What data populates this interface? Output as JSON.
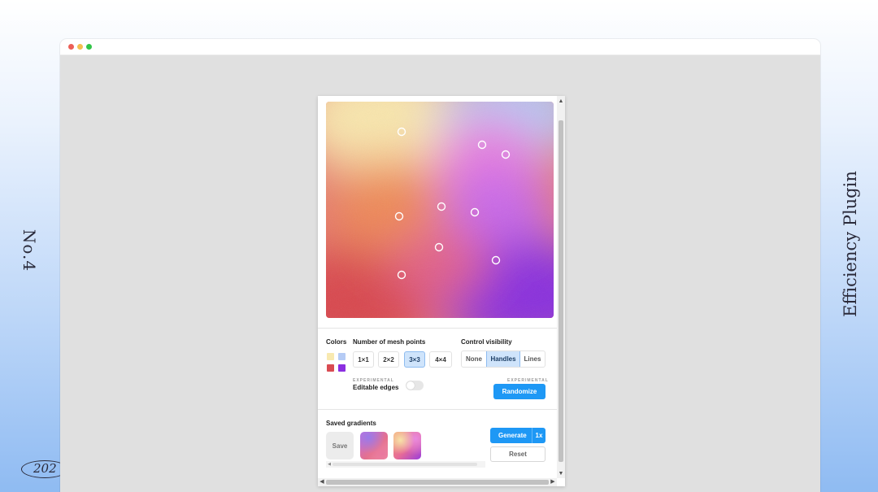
{
  "decor": {
    "left_text": "No.4",
    "right_text": "Efficiency Plugin",
    "year_text": "202"
  },
  "canvas": {
    "colors": [
      "#f8e9b0",
      "#b5cbf5",
      "#d94b52",
      "#8b2fe0"
    ]
  },
  "controls": {
    "colors_label": "Colors",
    "swatches": [
      "#f8e9b0",
      "#b5cbf5",
      "#d94b52",
      "#8b2fe0"
    ],
    "mesh_label": "Number of mesh points",
    "mesh_options": [
      "1×1",
      "2×2",
      "3×3",
      "4×4"
    ],
    "mesh_selected": "3×3",
    "visibility_label": "Control visibility",
    "visibility_options": [
      "None",
      "Handles",
      "Lines"
    ],
    "visibility_selected": "Handles",
    "experimental_tag": "EXPERIMENTAL",
    "editable_edges_label": "Editable edges",
    "editable_edges_on": false,
    "randomize_label": "Randomize"
  },
  "saved": {
    "label": "Saved gradients",
    "save_label": "Save",
    "generate_label": "Generate",
    "multiplier_label": "1x",
    "reset_label": "Reset"
  },
  "scroll": {
    "up_glyph": "▲",
    "down_glyph": "▼",
    "left_glyph": "◀",
    "right_glyph": "▶"
  }
}
